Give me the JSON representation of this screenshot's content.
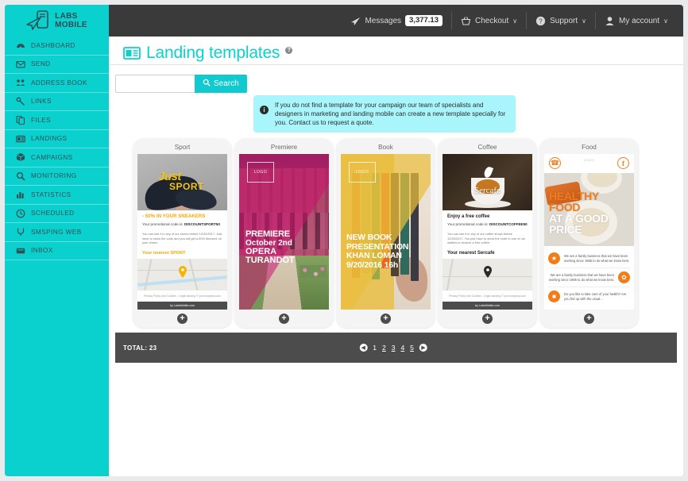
{
  "brand": {
    "name_line1": "LABS",
    "name_line2": "MOBILE",
    "logo_icon": "phone-paperplane-icon"
  },
  "topbar": {
    "items": [
      {
        "icon": "paper-plane-icon",
        "label": "Messages",
        "badge": "3,377.13",
        "caret": ""
      },
      {
        "icon": "basket-icon",
        "label": "Checkout",
        "badge": "",
        "caret": "∨"
      },
      {
        "icon": "question-circle-icon",
        "label": "Support",
        "badge": "",
        "caret": "∨"
      },
      {
        "icon": "user-icon",
        "label": "My account",
        "badge": "",
        "caret": "∨"
      }
    ]
  },
  "sidebar": {
    "items": [
      {
        "label": "DASHBOARD",
        "icon": "speedometer-icon"
      },
      {
        "label": "SEND",
        "icon": "envelope-icon"
      },
      {
        "label": "ADDRESS BOOK",
        "icon": "users-icon"
      },
      {
        "label": "LINKS",
        "icon": "link-icon"
      },
      {
        "label": "FILES",
        "icon": "files-icon"
      },
      {
        "label": "LANDINGS",
        "icon": "newspaper-icon"
      },
      {
        "label": "CAMPAIGNS",
        "icon": "box-icon"
      },
      {
        "label": "MONITORING",
        "icon": "magnifier-icon"
      },
      {
        "label": "STATISTICS",
        "icon": "bar-chart-icon"
      },
      {
        "label": "SCHEDULED",
        "icon": "clock-icon"
      },
      {
        "label": "SMSPING WEB",
        "icon": "ping-icon"
      },
      {
        "label": "INBOX",
        "icon": "inbox-icon"
      }
    ]
  },
  "page": {
    "title": "Landing templates",
    "title_icon": "newspaper-icon",
    "help_icon": "question-mark",
    "accent_color": "#0ad1ce"
  },
  "search": {
    "value": "",
    "placeholder": "",
    "button_label": "Search",
    "button_icon": "search-icon"
  },
  "info": {
    "icon": "info-icon",
    "text": "If you do not find a template for your campaign our team of specialists and designers in marketing and landing mobile can create a new template specially for you. Contact us to request a quote."
  },
  "templates": [
    {
      "title": "Sport",
      "add_icon": "plus-icon",
      "hero_title_1": "Just",
      "hero_title_2": "SPORT",
      "headline": "- 50% IN YOUR SNEAKERS",
      "body": "Your promotional code is: ",
      "code": "DISCOUNTSPORT50",
      "small": "You can use it in any of our stores before 12/31/2017. Just have to show the code and you will get a 50% discount on your shoes.",
      "near": "Your nearest SPORT",
      "legal": "Privacy Policy and Cookies - Legal warning © yourcompany.com",
      "foot": "by LabsMobile.com"
    },
    {
      "title": "Premiere",
      "add_icon": "plus-icon",
      "logo_placeholder": "LOGO",
      "line1": "PREMIERE",
      "line2": "October 2nd",
      "line3": "OPERA",
      "line4": "TURANDOT"
    },
    {
      "title": "Book",
      "add_icon": "plus-icon",
      "logo_placeholder": "LOGO",
      "line1": "NEW BOOK",
      "line2": "PRESENTATION",
      "line3": "KHAN LOMAN",
      "line4": "9/20/2016 16h"
    },
    {
      "title": "Coffee",
      "add_icon": "plus-icon",
      "brand": "Sercafe",
      "headline": "Enjoy a free coffee",
      "body": "Your promotional code is: ",
      "code": "DISCOUNTCOFFEE50",
      "small": "You can use it in any of our coffee shops before 12/30/2017. You just have to show the code to one of our waiters to receive a free coffee.",
      "near": "Your nearest Sercafe",
      "legal": "Privacy Policy and Cookies - Legal warning © yourcompany.com",
      "foot": "by LabsMobile.com"
    },
    {
      "title": "Food",
      "add_icon": "plus-icon",
      "logo_placeholder": "LOGO",
      "phone_icon": "phone-icon",
      "facebook_icon": "facebook-icon",
      "line1": "HEALTHY",
      "line2": "FOOD",
      "line3": "AT A GOOD",
      "line4": "PRICE",
      "rows": [
        {
          "icon": "gift-icon",
          "text": "We are a family business that we have been working since 1985 to do what we know best."
        },
        {
          "icon": "leaf-icon",
          "text": "We are a family business that we have been working since 1985 to do what we know best."
        },
        {
          "icon": "box-icon",
          "text": "Do you like to take care of your health? Are you fed up with the usual..."
        }
      ]
    }
  ],
  "footer": {
    "total_label": "TOTAL: 23",
    "prev_icon": "chevron-left-icon",
    "next_icon": "chevron-right-icon",
    "pages": [
      {
        "label": "1",
        "current": true
      },
      {
        "label": "2",
        "current": false
      },
      {
        "label": "3",
        "current": false
      },
      {
        "label": "4",
        "current": false
      },
      {
        "label": "5",
        "current": false
      }
    ]
  }
}
